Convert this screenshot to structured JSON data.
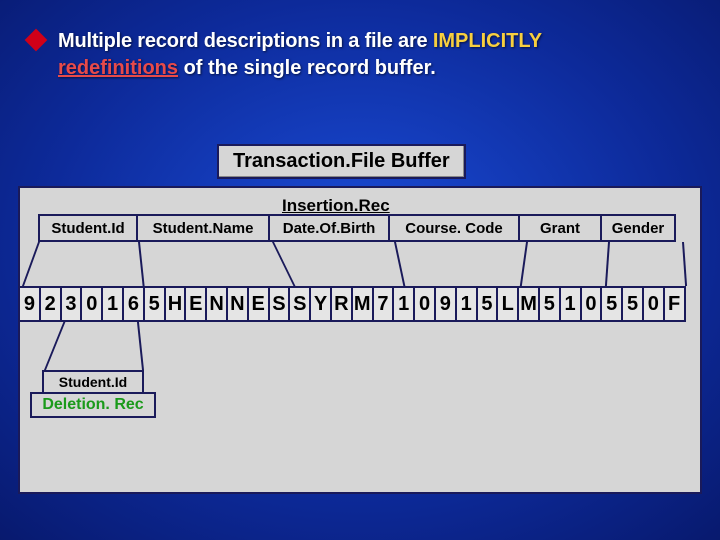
{
  "bullet": {
    "part1": "Multiple record descriptions in a file are ",
    "implicitly": "IMPLICITLY",
    "redef": "redefinitions",
    "part2": " of the single record buffer."
  },
  "title": "Transaction.File  Buffer",
  "insertionRec": {
    "heading": "Insertion.Rec",
    "fields": {
      "studentId": "Student.Id",
      "studentName": "Student.Name",
      "dob": "Date.Of.Birth",
      "courseCode": "Course. Code",
      "grant": "Grant",
      "gender": "Gender"
    }
  },
  "buffer": [
    "9",
    "2",
    "3",
    "0",
    "1",
    "6",
    "5",
    "H",
    "E",
    "N",
    "N",
    "E",
    "S",
    "S",
    "Y",
    "R",
    "M",
    "7",
    "1",
    "0",
    "9",
    "1",
    "5",
    "L",
    "M",
    "5",
    "1",
    "0",
    "5",
    "5",
    "0",
    "F"
  ],
  "deletionRec": {
    "field": "Student.Id",
    "heading": "Deletion. Rec"
  }
}
